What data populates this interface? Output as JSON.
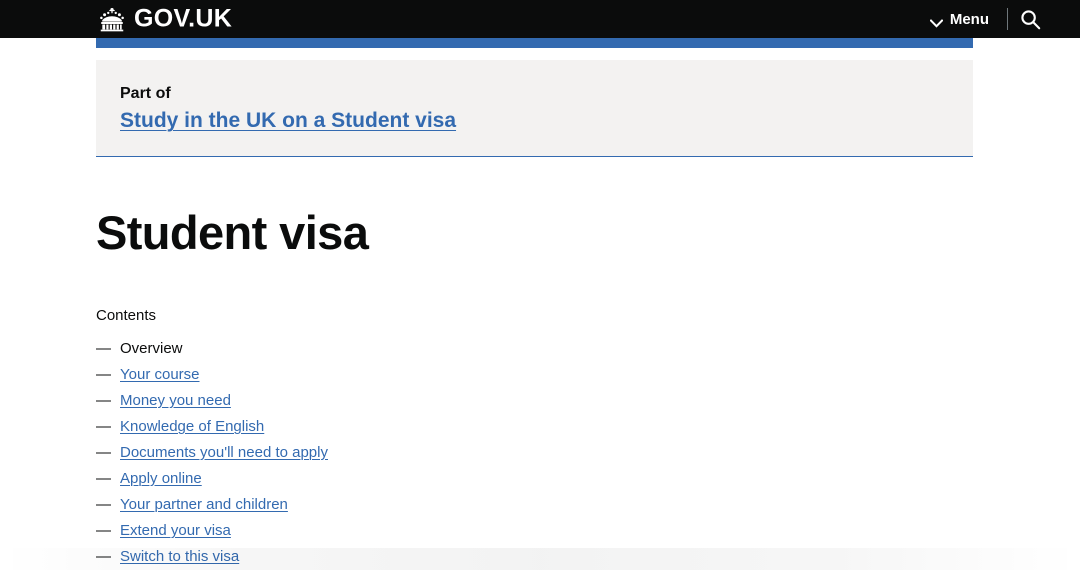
{
  "header": {
    "brand_name": "GOV.UK",
    "crown_icon": "crown-icon",
    "menu_label": "Menu",
    "menu_chevron_icon": "chevron-down-icon",
    "search_icon": "search-icon",
    "background_color": "#0b0c0c",
    "accent_bar_color": "#336ab0"
  },
  "part_of": {
    "label": "Part of",
    "link_text": "Study in the UK on a Student visa",
    "panel_background": "#f3f2f1",
    "border_color": "#336ab0",
    "link_color": "#336ab0"
  },
  "main": {
    "title": "Student visa"
  },
  "contents": {
    "label": "Contents",
    "items": [
      {
        "label": "Overview",
        "is_link": false
      },
      {
        "label": "Your course",
        "is_link": true
      },
      {
        "label": "Money you need",
        "is_link": true
      },
      {
        "label": "Knowledge of English",
        "is_link": true
      },
      {
        "label": "Documents you'll need to apply",
        "is_link": true
      },
      {
        "label": "Apply online",
        "is_link": true
      },
      {
        "label": "Your partner and children",
        "is_link": true
      },
      {
        "label": "Extend your visa",
        "is_link": true
      },
      {
        "label": "Switch to this visa",
        "is_link": true
      }
    ]
  }
}
